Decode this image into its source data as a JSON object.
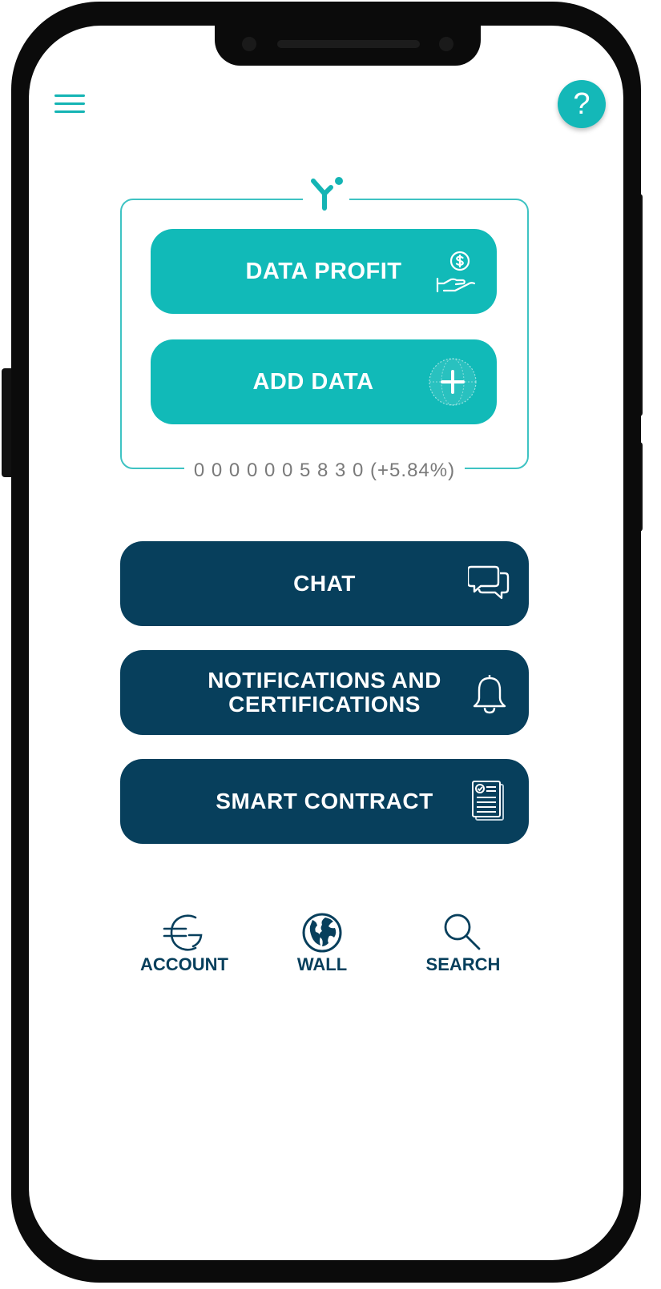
{
  "header": {
    "help_label": "?"
  },
  "data_card": {
    "balance": "0 0 0 0 0 0 5 8 3 0 (+5.84%)",
    "buttons": [
      {
        "label": "DATA PROFIT",
        "icon": "money-hand-icon"
      },
      {
        "label": "ADD DATA",
        "icon": "add-data-globe-icon"
      }
    ]
  },
  "actions": [
    {
      "label_line1": "CHAT",
      "label_line2": "",
      "icon": "chat-bubbles-icon"
    },
    {
      "label_line1": "NOTIFICATIONS AND",
      "label_line2": "CERTIFICATIONS",
      "icon": "bell-icon"
    },
    {
      "label_line1": "SMART CONTRACT",
      "label_line2": "",
      "icon": "document-icon"
    }
  ],
  "bottom_nav": [
    {
      "label": "ACCOUNT",
      "icon": "euro-icon"
    },
    {
      "label": "WALL",
      "icon": "globe-icon"
    },
    {
      "label": "SEARCH",
      "icon": "search-icon"
    }
  ],
  "colors": {
    "teal": "#11bab8",
    "navy": "#073f5c",
    "frame": "#0b0b0b"
  }
}
